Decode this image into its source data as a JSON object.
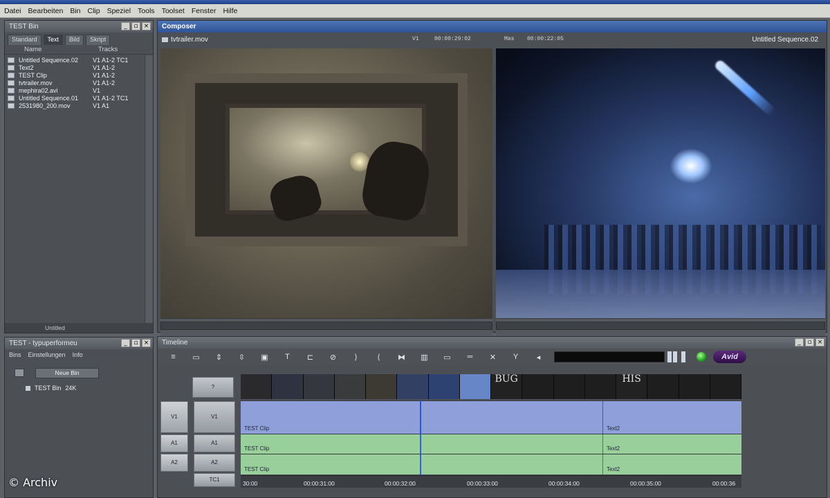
{
  "menu": [
    "Datei",
    "Bearbeiten",
    "Bin",
    "Clip",
    "Speziel",
    "Tools",
    "Toolset",
    "Fenster",
    "Hilfe"
  ],
  "bin_panel": {
    "title": "TEST Bin",
    "tabs": [
      "Standard",
      "Text",
      "Bild",
      "Skript"
    ],
    "active_tab": "Text",
    "col_name": "Name",
    "col_tracks": "Tracks",
    "rows": [
      {
        "name": "Untitled Sequence.02",
        "tracks": "V1 A1-2 TC1"
      },
      {
        "name": "Text2",
        "tracks": "V1 A1-2"
      },
      {
        "name": "TEST Clip",
        "tracks": "V1 A1-2"
      },
      {
        "name": "tvtrailer.mov",
        "tracks": "V1 A1-2"
      },
      {
        "name": "mephira02.avi",
        "tracks": "V1"
      },
      {
        "name": "Untitled Sequence.01",
        "tracks": "V1 A1-2 TC1"
      },
      {
        "name": "2531980_200.mov",
        "tracks": "V1 A1"
      }
    ],
    "footer": "Untitled"
  },
  "settings_panel": {
    "title": "TEST - typuperformeu",
    "tabs": [
      "Bins",
      "Einstellungen",
      "Info"
    ],
    "new_bin": "Neue Bin",
    "entry_name": "TEST Bin",
    "entry_size": "24K"
  },
  "composer": {
    "title": "Composer",
    "source_clip": "tvtrailer.mov",
    "v1_label": "V1",
    "v1_tc": "00:00:29:02",
    "mas_label": "Mas",
    "mas_tc": "00:00:22:05",
    "record_sequence": "Untitled Sequence.02"
  },
  "timeline": {
    "title": "Timeline",
    "question": "?",
    "avid_logo": "Avid",
    "track_labels_left": [
      "V1",
      "A1",
      "A2"
    ],
    "track_labels_right": [
      "V1",
      "A1",
      "A2",
      "TC1"
    ],
    "v1": [
      {
        "label": "TEST Clip"
      },
      {
        "label": ""
      },
      {
        "label": "Text2"
      }
    ],
    "a1": [
      {
        "label": "TEST Clip"
      },
      {
        "label": ""
      },
      {
        "label": "Text2"
      }
    ],
    "a2": [
      {
        "label": "TEST Clip"
      },
      {
        "label": ""
      },
      {
        "label": "Text2"
      }
    ],
    "ruler": [
      "30:00",
      "00:00:31:00",
      "00:00:32:00",
      "00:00:33:00",
      "00:00:34:00",
      "00:00:35:00",
      "00:00:36"
    ],
    "thumb_text": [
      "BUG",
      "HIS"
    ],
    "colors": {
      "video": "#8e9fd9",
      "audio": "#98cf9b"
    }
  },
  "watermark": "© Archiv"
}
